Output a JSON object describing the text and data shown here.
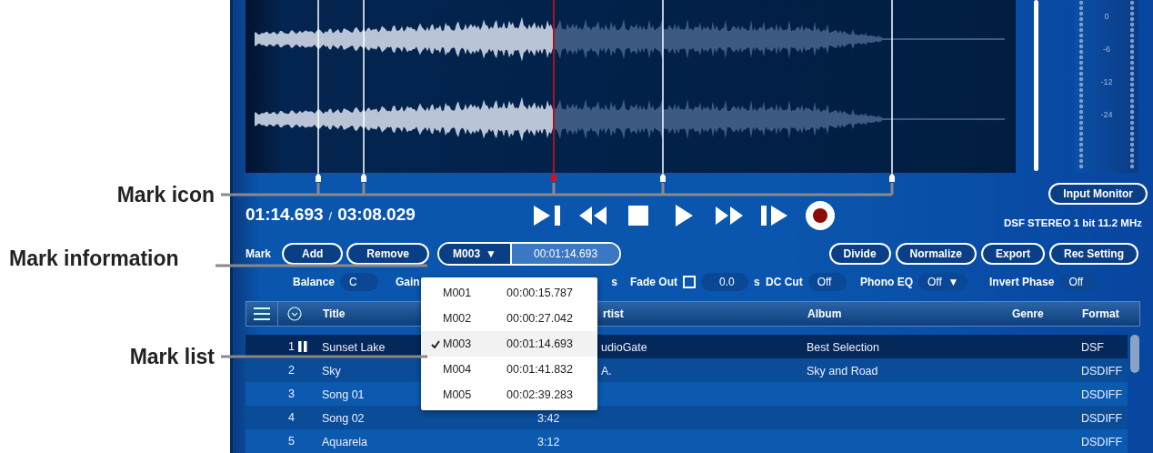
{
  "callouts": [
    {
      "label": "Mark icon"
    },
    {
      "label": "Mark information"
    },
    {
      "label": "Mark list"
    }
  ],
  "waveform": {
    "marks": [
      {
        "selected": false
      },
      {
        "selected": false
      },
      {
        "selected": true
      },
      {
        "selected": false
      },
      {
        "selected": false
      }
    ]
  },
  "meter": {
    "scale": [
      "0",
      "-6",
      "-12",
      "-24"
    ]
  },
  "input_monitor": "Input Monitor",
  "time": {
    "position": "01:14.693",
    "separator": "/",
    "duration": "03:08.029"
  },
  "transport": [
    {
      "kind": "play-mark"
    },
    {
      "kind": "rewind"
    },
    {
      "kind": "stop"
    },
    {
      "kind": "play"
    },
    {
      "kind": "forward"
    },
    {
      "kind": "step"
    },
    {
      "kind": "record"
    }
  ],
  "format_info": "DSF STEREO 1 bit 11.2 MHz",
  "mark_bar": {
    "label": "Mark",
    "buttons": [
      "Add",
      "Remove"
    ],
    "current": "M003",
    "caret": "▼",
    "current_time": "00:01:14.693"
  },
  "edit_buttons": [
    "Divide",
    "Normalize",
    "Export",
    "Rec Setting"
  ],
  "settings": [
    {
      "kind": "value",
      "label": "Balance",
      "value": "C"
    },
    {
      "kind": "hidden",
      "label": "Gain",
      "unit": "s"
    },
    {
      "kind": "check",
      "label": "Fade Out",
      "checked": false,
      "value": "0.0",
      "unit": "s"
    },
    {
      "kind": "value",
      "label": "DC Cut",
      "value": "Off"
    },
    {
      "kind": "select",
      "label": "Phono EQ",
      "value": "Off",
      "caret": "▼"
    },
    {
      "kind": "value",
      "label": "Invert Phase",
      "value": "Off"
    }
  ],
  "table": {
    "columns": [
      "Title",
      "rtist",
      "Album",
      "Genre",
      "Format"
    ],
    "rows": [
      {
        "number": "1",
        "playing": true,
        "selected": true,
        "title": "Sunset Lake",
        "artist": "udioGate",
        "album": "Best Selection",
        "format": "DSF"
      },
      {
        "number": "2",
        "playing": false,
        "selected": false,
        "title": "Sky",
        "artist": "A.",
        "album": "Sky and Road",
        "format": "DSDIFF"
      },
      {
        "number": "3",
        "playing": false,
        "selected": false,
        "title": "Song 01",
        "format": "DSDIFF"
      },
      {
        "number": "4",
        "playing": false,
        "selected": false,
        "title": "Song 02",
        "time": "3:42",
        "format": "DSDIFF"
      },
      {
        "number": "5",
        "playing": false,
        "selected": false,
        "title": "Aquarela",
        "time": "3:12",
        "format": "DSDIFF"
      }
    ]
  },
  "mark_list": [
    {
      "name": "M001",
      "time": "00:00:15.787",
      "selected": false
    },
    {
      "name": "M002",
      "time": "00:00:27.042",
      "selected": false
    },
    {
      "name": "M003",
      "time": "00:01:14.693",
      "selected": true
    },
    {
      "name": "M004",
      "time": "00:01:41.832",
      "selected": false
    },
    {
      "name": "M005",
      "time": "00:02:39.283",
      "selected": false
    }
  ]
}
